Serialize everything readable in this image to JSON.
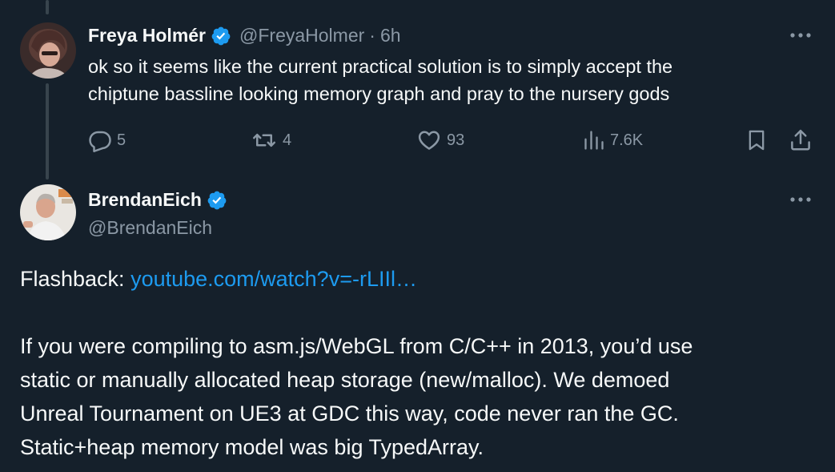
{
  "tweet1": {
    "name": "Freya Holmér",
    "handle": "@FreyaHolmer",
    "separator": "·",
    "time": "6h",
    "text_line1": "ok so it seems like the current practical solution is to simply accept the",
    "text_line2": "chiptune bassline looking memory graph and pray to the nursery gods",
    "actions": {
      "replies": "5",
      "retweets": "4",
      "likes": "93",
      "views": "7.6K"
    }
  },
  "tweet2": {
    "name": "BrendanEich",
    "handle": "@BrendanEich",
    "flashback_label": "Flashback: ",
    "link_text": "youtube.com/watch?v=-rLIIl…",
    "lines": [
      "If you were compiling to asm.js/WebGL from C/C++ in 2013, you’d use",
      "static or manually allocated heap storage (new/malloc). We demoed",
      "Unreal Tournament on UE3 at GDC this way, code never ran the GC.",
      "Static+heap memory model was big TypedArray."
    ]
  },
  "colors": {
    "background": "#15202b",
    "text": "#f7f9f9",
    "muted": "#8b98a5",
    "link": "#1d9bf0",
    "verified": "#1d9bf0",
    "thread_line": "#38444d"
  }
}
